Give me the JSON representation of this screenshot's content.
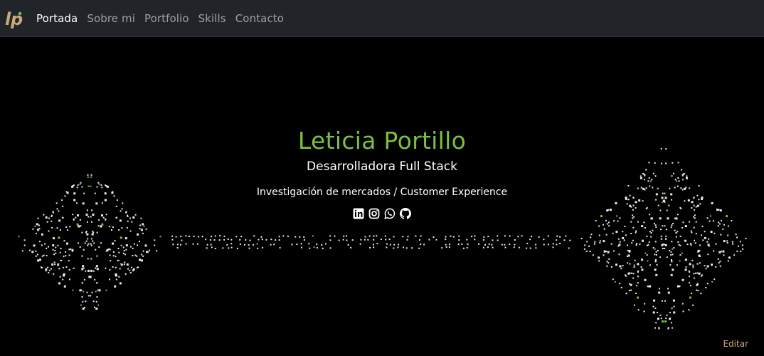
{
  "nav": {
    "logo_text": "LP",
    "items": [
      {
        "label": "Portada",
        "active": true
      },
      {
        "label": "Sobre mi",
        "active": false
      },
      {
        "label": "Portfolio",
        "active": false
      },
      {
        "label": "Skills",
        "active": false
      },
      {
        "label": "Contacto",
        "active": false
      }
    ]
  },
  "hero": {
    "name": "Leticia Portillo",
    "role": "Desarrolladora Full Stack",
    "tagline": "Investigación de mercados / Customer Experience",
    "socials": [
      {
        "icon": "linkedin-icon"
      },
      {
        "icon": "instagram-icon"
      },
      {
        "icon": "whatsapp-icon"
      },
      {
        "icon": "github-icon"
      }
    ],
    "edit_label": "Editar"
  },
  "colors": {
    "accent": "#7ac142",
    "navbar_bg": "#212529",
    "background": "#000000",
    "edit_link": "#c8a97a"
  }
}
